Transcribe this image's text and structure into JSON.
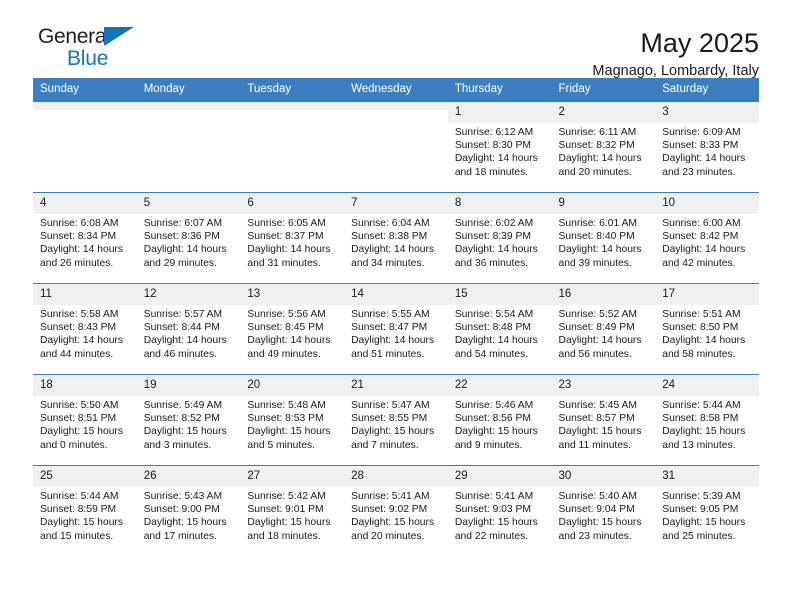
{
  "brand": {
    "name_line1": "General",
    "name_line2": "Blue",
    "primary_color": "#1275bc"
  },
  "header": {
    "title": "May 2025",
    "subtitle": "Magnago, Lombardy, Italy",
    "accent_color": "#3c7fc1"
  },
  "weekday_headers": [
    "Sunday",
    "Monday",
    "Tuesday",
    "Wednesday",
    "Thursday",
    "Friday",
    "Saturday"
  ],
  "weeks": [
    [
      {
        "day": "",
        "empty": true
      },
      {
        "day": "",
        "empty": true
      },
      {
        "day": "",
        "empty": true
      },
      {
        "day": "",
        "empty": true
      },
      {
        "day": "1",
        "sunrise": "Sunrise: 6:12 AM",
        "sunset": "Sunset: 8:30 PM",
        "daylight_line1": "Daylight: 14 hours",
        "daylight_line2": "and 18 minutes."
      },
      {
        "day": "2",
        "sunrise": "Sunrise: 6:11 AM",
        "sunset": "Sunset: 8:32 PM",
        "daylight_line1": "Daylight: 14 hours",
        "daylight_line2": "and 20 minutes."
      },
      {
        "day": "3",
        "sunrise": "Sunrise: 6:09 AM",
        "sunset": "Sunset: 8:33 PM",
        "daylight_line1": "Daylight: 14 hours",
        "daylight_line2": "and 23 minutes."
      }
    ],
    [
      {
        "day": "4",
        "sunrise": "Sunrise: 6:08 AM",
        "sunset": "Sunset: 8:34 PM",
        "daylight_line1": "Daylight: 14 hours",
        "daylight_line2": "and 26 minutes."
      },
      {
        "day": "5",
        "sunrise": "Sunrise: 6:07 AM",
        "sunset": "Sunset: 8:36 PM",
        "daylight_line1": "Daylight: 14 hours",
        "daylight_line2": "and 29 minutes."
      },
      {
        "day": "6",
        "sunrise": "Sunrise: 6:05 AM",
        "sunset": "Sunset: 8:37 PM",
        "daylight_line1": "Daylight: 14 hours",
        "daylight_line2": "and 31 minutes."
      },
      {
        "day": "7",
        "sunrise": "Sunrise: 6:04 AM",
        "sunset": "Sunset: 8:38 PM",
        "daylight_line1": "Daylight: 14 hours",
        "daylight_line2": "and 34 minutes."
      },
      {
        "day": "8",
        "sunrise": "Sunrise: 6:02 AM",
        "sunset": "Sunset: 8:39 PM",
        "daylight_line1": "Daylight: 14 hours",
        "daylight_line2": "and 36 minutes."
      },
      {
        "day": "9",
        "sunrise": "Sunrise: 6:01 AM",
        "sunset": "Sunset: 8:40 PM",
        "daylight_line1": "Daylight: 14 hours",
        "daylight_line2": "and 39 minutes."
      },
      {
        "day": "10",
        "sunrise": "Sunrise: 6:00 AM",
        "sunset": "Sunset: 8:42 PM",
        "daylight_line1": "Daylight: 14 hours",
        "daylight_line2": "and 42 minutes."
      }
    ],
    [
      {
        "day": "11",
        "sunrise": "Sunrise: 5:58 AM",
        "sunset": "Sunset: 8:43 PM",
        "daylight_line1": "Daylight: 14 hours",
        "daylight_line2": "and 44 minutes."
      },
      {
        "day": "12",
        "sunrise": "Sunrise: 5:57 AM",
        "sunset": "Sunset: 8:44 PM",
        "daylight_line1": "Daylight: 14 hours",
        "daylight_line2": "and 46 minutes."
      },
      {
        "day": "13",
        "sunrise": "Sunrise: 5:56 AM",
        "sunset": "Sunset: 8:45 PM",
        "daylight_line1": "Daylight: 14 hours",
        "daylight_line2": "and 49 minutes."
      },
      {
        "day": "14",
        "sunrise": "Sunrise: 5:55 AM",
        "sunset": "Sunset: 8:47 PM",
        "daylight_line1": "Daylight: 14 hours",
        "daylight_line2": "and 51 minutes."
      },
      {
        "day": "15",
        "sunrise": "Sunrise: 5:54 AM",
        "sunset": "Sunset: 8:48 PM",
        "daylight_line1": "Daylight: 14 hours",
        "daylight_line2": "and 54 minutes."
      },
      {
        "day": "16",
        "sunrise": "Sunrise: 5:52 AM",
        "sunset": "Sunset: 8:49 PM",
        "daylight_line1": "Daylight: 14 hours",
        "daylight_line2": "and 56 minutes."
      },
      {
        "day": "17",
        "sunrise": "Sunrise: 5:51 AM",
        "sunset": "Sunset: 8:50 PM",
        "daylight_line1": "Daylight: 14 hours",
        "daylight_line2": "and 58 minutes."
      }
    ],
    [
      {
        "day": "18",
        "sunrise": "Sunrise: 5:50 AM",
        "sunset": "Sunset: 8:51 PM",
        "daylight_line1": "Daylight: 15 hours",
        "daylight_line2": "and 0 minutes."
      },
      {
        "day": "19",
        "sunrise": "Sunrise: 5:49 AM",
        "sunset": "Sunset: 8:52 PM",
        "daylight_line1": "Daylight: 15 hours",
        "daylight_line2": "and 3 minutes."
      },
      {
        "day": "20",
        "sunrise": "Sunrise: 5:48 AM",
        "sunset": "Sunset: 8:53 PM",
        "daylight_line1": "Daylight: 15 hours",
        "daylight_line2": "and 5 minutes."
      },
      {
        "day": "21",
        "sunrise": "Sunrise: 5:47 AM",
        "sunset": "Sunset: 8:55 PM",
        "daylight_line1": "Daylight: 15 hours",
        "daylight_line2": "and 7 minutes."
      },
      {
        "day": "22",
        "sunrise": "Sunrise: 5:46 AM",
        "sunset": "Sunset: 8:56 PM",
        "daylight_line1": "Daylight: 15 hours",
        "daylight_line2": "and 9 minutes."
      },
      {
        "day": "23",
        "sunrise": "Sunrise: 5:45 AM",
        "sunset": "Sunset: 8:57 PM",
        "daylight_line1": "Daylight: 15 hours",
        "daylight_line2": "and 11 minutes."
      },
      {
        "day": "24",
        "sunrise": "Sunrise: 5:44 AM",
        "sunset": "Sunset: 8:58 PM",
        "daylight_line1": "Daylight: 15 hours",
        "daylight_line2": "and 13 minutes."
      }
    ],
    [
      {
        "day": "25",
        "sunrise": "Sunrise: 5:44 AM",
        "sunset": "Sunset: 8:59 PM",
        "daylight_line1": "Daylight: 15 hours",
        "daylight_line2": "and 15 minutes."
      },
      {
        "day": "26",
        "sunrise": "Sunrise: 5:43 AM",
        "sunset": "Sunset: 9:00 PM",
        "daylight_line1": "Daylight: 15 hours",
        "daylight_line2": "and 17 minutes."
      },
      {
        "day": "27",
        "sunrise": "Sunrise: 5:42 AM",
        "sunset": "Sunset: 9:01 PM",
        "daylight_line1": "Daylight: 15 hours",
        "daylight_line2": "and 18 minutes."
      },
      {
        "day": "28",
        "sunrise": "Sunrise: 5:41 AM",
        "sunset": "Sunset: 9:02 PM",
        "daylight_line1": "Daylight: 15 hours",
        "daylight_line2": "and 20 minutes."
      },
      {
        "day": "29",
        "sunrise": "Sunrise: 5:41 AM",
        "sunset": "Sunset: 9:03 PM",
        "daylight_line1": "Daylight: 15 hours",
        "daylight_line2": "and 22 minutes."
      },
      {
        "day": "30",
        "sunrise": "Sunrise: 5:40 AM",
        "sunset": "Sunset: 9:04 PM",
        "daylight_line1": "Daylight: 15 hours",
        "daylight_line2": "and 23 minutes."
      },
      {
        "day": "31",
        "sunrise": "Sunrise: 5:39 AM",
        "sunset": "Sunset: 9:05 PM",
        "daylight_line1": "Daylight: 15 hours",
        "daylight_line2": "and 25 minutes."
      }
    ]
  ]
}
